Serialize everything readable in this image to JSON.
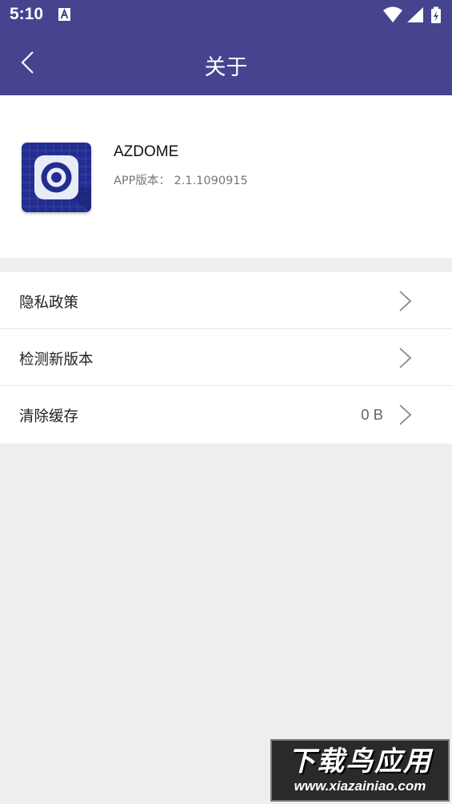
{
  "status_bar": {
    "time": "5:10",
    "icons": [
      "a-notification-icon",
      "wifi-icon",
      "signal-icon",
      "battery-charging-icon"
    ]
  },
  "app_bar": {
    "title": "关于",
    "back_icon": "back-chevron-icon"
  },
  "app_info": {
    "name": "AZDOME",
    "version": "APP版本： 2.1.1090915",
    "icon": "camera-eye-icon"
  },
  "menu": [
    {
      "label": "隐私政策",
      "value": ""
    },
    {
      "label": "检测新版本",
      "value": ""
    },
    {
      "label": "清除缓存",
      "value": "0 B"
    }
  ],
  "watermark": {
    "title": "下载鸟应用",
    "url": "www.xiazainiao.com"
  },
  "colors": {
    "primary": "#46448f",
    "background": "#eeeeee",
    "card": "#ffffff"
  }
}
